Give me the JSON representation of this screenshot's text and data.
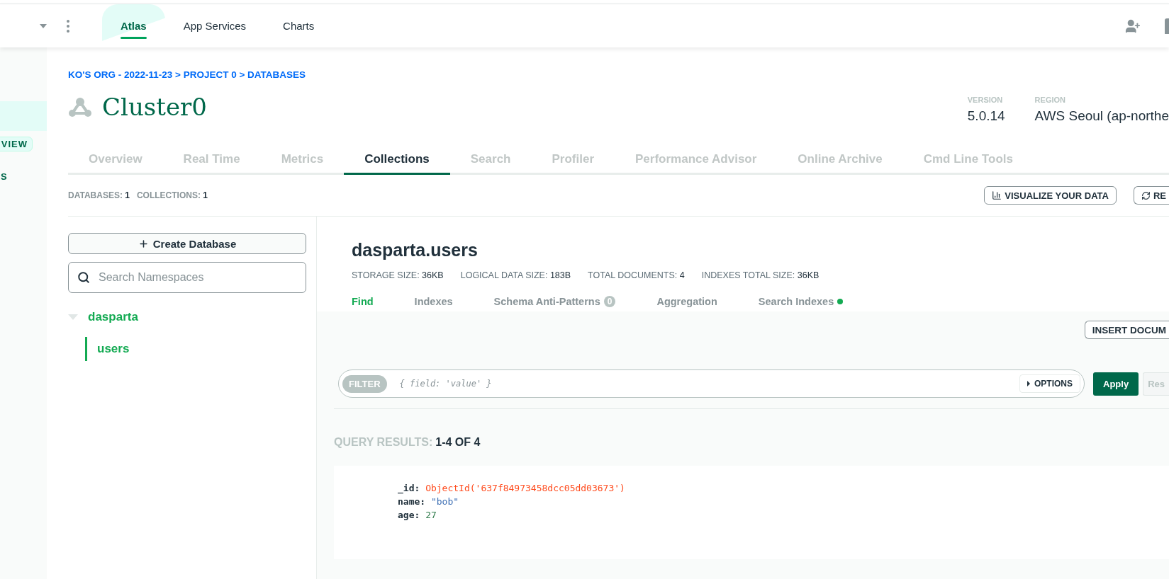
{
  "top_nav": {
    "tabs": [
      {
        "label": "Atlas",
        "selected": true
      },
      {
        "label": "App Services",
        "selected": false
      },
      {
        "label": "Charts",
        "selected": false
      }
    ]
  },
  "sidebar": {
    "items": [
      {
        "kind": "row",
        "selected": true
      },
      {
        "kind": "badge",
        "label": "VIEW"
      },
      {
        "kind": "text",
        "label": "S"
      }
    ]
  },
  "breadcrumb": "KO'S ORG - 2022-11-23 > PROJECT 0 > DATABASES",
  "cluster": {
    "name": "Cluster0",
    "info": [
      {
        "label": "VERSION",
        "value": "5.0.14"
      },
      {
        "label": "REGION",
        "value": "AWS Seoul (ap-northe"
      }
    ]
  },
  "tabs": [
    {
      "label": "Overview",
      "selected": false
    },
    {
      "label": "Real Time",
      "selected": false
    },
    {
      "label": "Metrics",
      "selected": false
    },
    {
      "label": "Collections",
      "selected": true
    },
    {
      "label": "Search",
      "selected": false
    },
    {
      "label": "Profiler",
      "selected": false
    },
    {
      "label": "Performance Advisor",
      "selected": false
    },
    {
      "label": "Online Archive",
      "selected": false
    },
    {
      "label": "Cmd Line Tools",
      "selected": false
    }
  ],
  "stats": [
    {
      "label": "DATABASES:",
      "value": "1"
    },
    {
      "label": "COLLECTIONS:",
      "value": "1"
    }
  ],
  "actions": [
    {
      "kind": "chart",
      "label": "VISUALIZE YOUR DATA"
    },
    {
      "kind": "refresh",
      "label": "RE"
    }
  ],
  "create_button": "Create Database",
  "search": {
    "placeholder": "Search Namespaces"
  },
  "tree": [
    {
      "label": "dasparta",
      "expanded": true,
      "children": [
        {
          "label": "users",
          "selected": true
        }
      ]
    }
  ],
  "collection": {
    "title": "dasparta.users",
    "stats": [
      {
        "label": "STORAGE SIZE:",
        "value": "36KB"
      },
      {
        "label": "LOGICAL DATA SIZE:",
        "value": "183B"
      },
      {
        "label": "TOTAL DOCUMENTS:",
        "value": "4"
      },
      {
        "label": "INDEXES TOTAL SIZE:",
        "value": "36KB"
      }
    ],
    "tabs": [
      {
        "label": "Find",
        "selected": true
      },
      {
        "label": "Indexes",
        "selected": false
      },
      {
        "label": "Schema Anti-Patterns",
        "selected": false,
        "count": "0"
      },
      {
        "label": "Aggregation",
        "selected": false
      },
      {
        "label": "Search Indexes",
        "selected": false,
        "color": "#13aa52"
      }
    ]
  },
  "insert_button": "INSERT DOCUM",
  "filter": {
    "tag": "FILTER",
    "placeholder": "{ field: 'value' }",
    "options": "OPTIONS",
    "apply": "Apply",
    "reset": "Res"
  },
  "results": {
    "label": "QUERY RESULTS:",
    "range": "1-4 OF 4"
  },
  "documents": [
    {
      "fields": [
        {
          "key": "_id:",
          "value": "ObjectId('637f84973458dcc05dd03673')",
          "kind": "objectid"
        },
        {
          "key": "name:",
          "value": "\"bob\"",
          "kind": "string"
        },
        {
          "key": "age:",
          "value": "27",
          "kind": "number"
        }
      ]
    }
  ]
}
